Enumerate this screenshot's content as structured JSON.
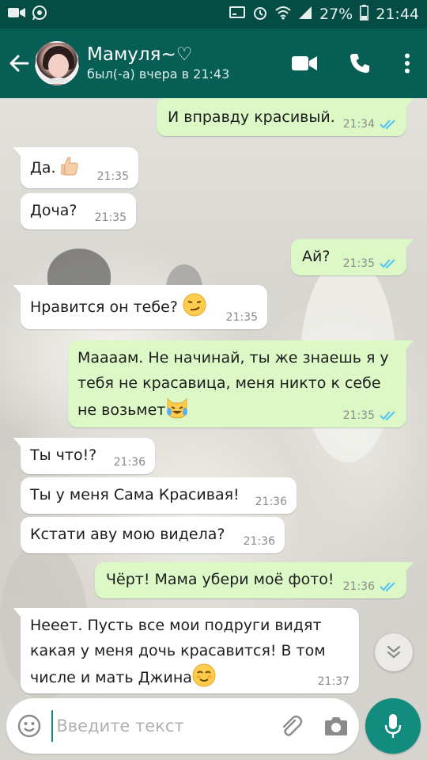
{
  "status_bar": {
    "battery": "27%",
    "time": "21:44"
  },
  "header": {
    "contact_name": "Мамуля~♡",
    "last_seen": "был(-а) вчера в 21:43"
  },
  "messages": [
    {
      "dir": "out",
      "text": "И вправду красивый.",
      "time": "21:34",
      "read": true
    },
    {
      "dir": "in",
      "text": "Да.",
      "emoji": "thumbs-up",
      "time": "21:35"
    },
    {
      "dir": "in",
      "text": "Доча?",
      "time": "21:35"
    },
    {
      "dir": "out",
      "text": "Ай?",
      "time": "21:35",
      "read": true
    },
    {
      "dir": "in",
      "text": "Нравится он тебе?",
      "emoji": "smirk",
      "time": "21:35"
    },
    {
      "dir": "out",
      "text_lines": [
        "Маааам. Не начинай, ты же знаешь я у",
        "тебя не красавица, меня никто к себе",
        "не возьмет"
      ],
      "emoji": "crying-laughing-cat",
      "time": "21:35",
      "read": true
    },
    {
      "dir": "in",
      "text": "Ты что!?",
      "time": "21:36"
    },
    {
      "dir": "in",
      "text": "Ты у меня Сама Красивая!",
      "time": "21:36"
    },
    {
      "dir": "in",
      "text": "Кстати аву мою видела?",
      "time": "21:36"
    },
    {
      "dir": "out",
      "text": "Чёрт! Мама убери моё фото!",
      "time": "21:36",
      "read": true
    },
    {
      "dir": "in",
      "text_lines": [
        "Нееет. Пусть все мои подруги видят",
        "какая у меня дочь красавится! В том",
        "числе и мать Джина"
      ],
      "emoji": "smiling-blush",
      "time": "21:37"
    }
  ],
  "input": {
    "placeholder": "Введите текст"
  },
  "colors": {
    "status_bar": "#054d44",
    "app_bar": "#075e54",
    "outgoing_bubble": "#dcf8c6",
    "incoming_bubble": "#ffffff",
    "read_ticks": "#4fc3f7",
    "mic_button": "#128c7e"
  },
  "icons": {
    "back": "arrow-left-icon",
    "video_call": "video-camera-icon",
    "voice_call": "phone-icon",
    "menu": "more-vertical-icon",
    "emoji": "smiley-icon",
    "attach": "paperclip-icon",
    "camera": "camera-icon",
    "mic": "microphone-icon",
    "scroll_down": "double-chevron-down-icon"
  }
}
